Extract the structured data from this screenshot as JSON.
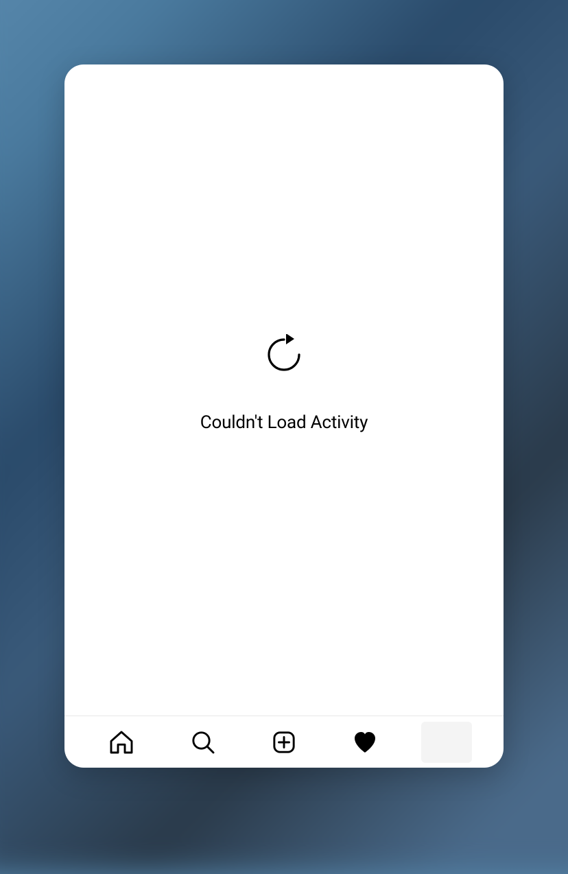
{
  "error": {
    "message": "Couldn't Load Activity",
    "retry_icon": "refresh-icon"
  },
  "nav": {
    "home": "home-icon",
    "search": "search-icon",
    "create": "plus-square-icon",
    "activity": "heart-icon",
    "profile": "profile-icon",
    "active": "activity"
  }
}
